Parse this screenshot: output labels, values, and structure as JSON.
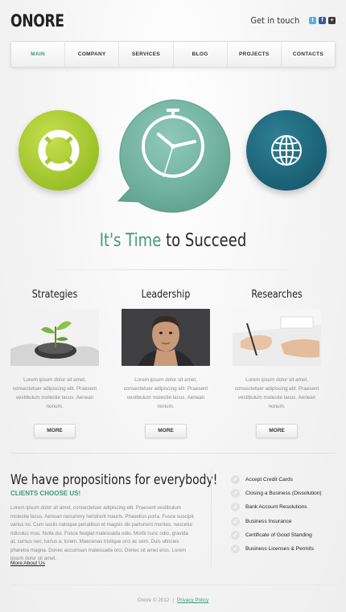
{
  "header": {
    "logo": "ONORE",
    "touch_label": "Get in touch",
    "social": [
      {
        "name": "twitter",
        "glyph": "t",
        "color": "#4ab3e3"
      },
      {
        "name": "facebook",
        "glyph": "f",
        "color": "#3b5998"
      },
      {
        "name": "googleplus",
        "glyph": "+",
        "color": "#3a3a3a"
      }
    ]
  },
  "nav": {
    "items": [
      "MAIN",
      "COMPANY",
      "SERVICES",
      "BLOG",
      "PROJECTS",
      "CONTACTS"
    ],
    "active": "MAIN"
  },
  "hero": {
    "headline_accent": "It's Time",
    "headline_rest": " to Succeed",
    "icons": [
      "lifebuoy-icon",
      "clock-icon",
      "globe-icon"
    ],
    "colors": {
      "green": "#a6c832",
      "teal": "#7cb9a8",
      "dark_teal": "#1e6478"
    }
  },
  "columns": [
    {
      "title": "Strategies",
      "text": "Lorem ipsum dolor sit amet, consectetuer adipiscing elit. Praesent vestibulum molestie lacus. Aenean nonum.",
      "button": "MORE",
      "image": "plant-in-hands-photo"
    },
    {
      "title": "Leadership",
      "text": "Lorem ipsum dolor sit amet, consectetuer adipiscing elit. Praesent vestibulum molestie lacus. Aenean nonum.",
      "button": "MORE",
      "image": "man-portrait-photo"
    },
    {
      "title": "Researches",
      "text": "Lorem ipsum dolor sit amet, consectetuer adipiscing elit. Praesent vestibulum molestie lacus. Aenean nonum.",
      "button": "MORE",
      "image": "writing-hands-photo"
    }
  ],
  "propositions": {
    "title": "We have propositions for everybody!",
    "subtitle": "CLIENTS CHOOSE US!",
    "body": "Lorem ipsum dolor sit amet, consectetuer adipiscing elit. Praesent vestibulum molestie lacus. Aenean nonummy hendrerit mauris. Phasellus porta. Fusce suscipit varius mi. Cum sociis natoque penatibus et magnis dis parturient montes, nascetur ridiculus mus. Nulla dui. Fusce feugiat malesuada odio. Morbi nunc odio, gravida at, cursus nec, luctus a, lorem. Maecenas tristique orci ac sem. Duis ultricies pharetra magna. Donec accumsan malesuada orci. Donec sit amet eros. Lorem ipsum dolor sit amet.",
    "link": "More About Us",
    "checklist": [
      "Accept Credit Cards",
      "Closing a Business (Dissolution)",
      "Bank Account Resolutions",
      "Business Insurance",
      "Certificate of Good Standing",
      "Business Licenses & Permits"
    ]
  },
  "footer": {
    "copyright": "Onore © 2012",
    "separator": "|",
    "privacy": "Privacy Policy"
  }
}
